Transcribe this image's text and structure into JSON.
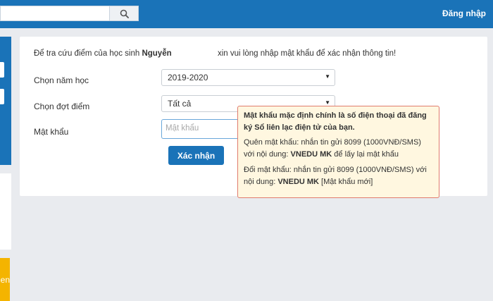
{
  "header": {
    "search_value": "",
    "search_icon": "search-icon",
    "login_label": "Đăng nhập",
    "bg_color": "#1a73b8"
  },
  "left_sidebar": {
    "yellow_text": "en"
  },
  "form": {
    "intro_prefix": "Để tra cứu điểm của học sinh ",
    "student_name": "Nguyễn",
    "intro_suffix": "xin vui lòng nhập mật khẩu để xác nhận thông tin!",
    "year_label": "Chọn năm học",
    "year_value": "2019-2020",
    "period_label": "Chọn đợt điểm",
    "period_value": "Tất cả",
    "password_label": "Mật khẩu",
    "password_placeholder": "Mật khẩu",
    "submit_label": "Xác nhận"
  },
  "tooltip": {
    "title": "Mật khẩu mặc định chính là số điện thoại đã đăng ký Sổ liên lạc điện tử của bạn.",
    "forgot_text": "Quên mật khẩu: nhắn tin gửi 8099 (1000VNĐ/SMS) với nội dung: ",
    "forgot_code": "VNEDU MK",
    "forgot_suffix": " để lấy lại mật khẩu",
    "change_text": "Đổi mật khẩu: nhắn tin gửi 8099 (1000VNĐ/SMS) với nội dung: ",
    "change_code": "VNEDU MK",
    "change_suffix": " [Mật khẩu mới]",
    "border_color": "#e07b6d",
    "bg_color": "#fff7e0"
  }
}
